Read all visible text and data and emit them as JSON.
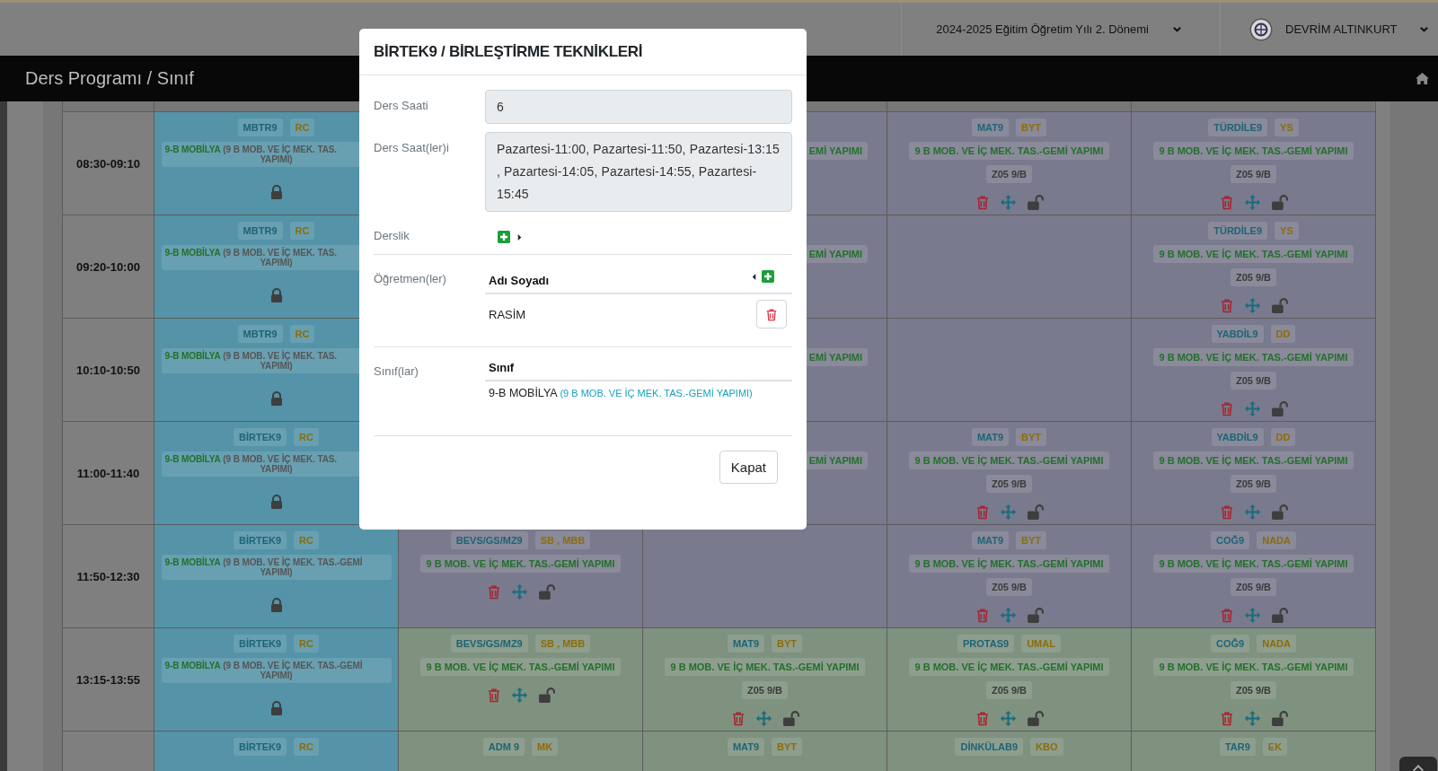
{
  "top_bar": {
    "semester": "2024-2025 Eğitim Öğretim Yılı 2. Dönemi",
    "user": "DEVRİM ALTINKURT"
  },
  "page_title": "Ders Programı / Sınıf",
  "timetable": {
    "rows": [
      {
        "time": "08:30-09:10",
        "cells": [
          {
            "kind": "locked",
            "color": "#5493a8",
            "course": "MBTR9",
            "teacher": "RC",
            "class": "9-B MOBİLYA",
            "detail": [
              "(9 B MOB. VE İÇ MEK. TAS.",
              "YAPIMI)"
            ]
          },
          {
            "kind": "empty"
          },
          {
            "kind": "partial",
            "color": "#7a7a8e",
            "text": "EMİ YAPIMI"
          },
          {
            "kind": "lesson",
            "color": "#7a7a8e",
            "course": "MAT9",
            "teacher": "BYT",
            "group": "9 B MOB. VE İÇ MEK. TAS.-GEMİ YAPIMI",
            "room": "Z05 9/B"
          },
          {
            "kind": "lesson",
            "color": "#7a7a8e",
            "course": "TÜRDİLE9",
            "teacher": "YS",
            "group": "9 B MOB. VE İÇ MEK. TAS.-GEMİ YAPIMI",
            "room": "Z05 9/B"
          }
        ]
      },
      {
        "time": "09:20-10:00",
        "cells": [
          {
            "kind": "locked",
            "color": "#5493a8",
            "course": "MBTR9",
            "teacher": "RC",
            "class": "9-B MOBİLYA",
            "detail": [
              "(9 B MOB. VE İÇ MEK. TAS.",
              "YAPIMI)"
            ]
          },
          {
            "kind": "empty"
          },
          {
            "kind": "partial",
            "color": "#7a7a8e",
            "text": "EMİ YAPIMI"
          },
          {
            "kind": "empty",
            "color": "#7a7a8e"
          },
          {
            "kind": "lesson",
            "color": "#7a7a8e",
            "course": "TÜRDİLE9",
            "teacher": "YS",
            "group": "9 B MOB. VE İÇ MEK. TAS.-GEMİ YAPIMI",
            "room": "Z05 9/B"
          }
        ]
      },
      {
        "time": "10:10-10:50",
        "cells": [
          {
            "kind": "locked",
            "color": "#5493a8",
            "course": "MBTR9",
            "teacher": "RC",
            "class": "9-B MOBİLYA",
            "detail": [
              "(9 B MOB. VE İÇ MEK. TAS.",
              "YAPIMI)"
            ]
          },
          {
            "kind": "empty"
          },
          {
            "kind": "partial",
            "color": "#7a7a8e",
            "text": "EMİ YAPIMI"
          },
          {
            "kind": "empty",
            "color": "#7a7a8e"
          },
          {
            "kind": "lesson",
            "color": "#7a7a8e",
            "course": "YABDİL9",
            "teacher": "DD",
            "group": "9 B MOB. VE İÇ MEK. TAS.-GEMİ YAPIMI",
            "room": "Z05 9/B"
          }
        ]
      },
      {
        "time": "11:00-11:40",
        "cells": [
          {
            "kind": "locked",
            "color": "#5493a8",
            "course": "BİRTEK9",
            "teacher": "RC",
            "class": "9-B MOBİLYA",
            "detail": [
              "(9 B MOB. VE İÇ MEK. TAS.",
              "YAPIMI)"
            ]
          },
          {
            "kind": "empty"
          },
          {
            "kind": "partial",
            "color": "#7a7a8e",
            "text": "EMİ YAPIMI"
          },
          {
            "kind": "lesson",
            "color": "#7a7a8e",
            "course": "MAT9",
            "teacher": "BYT",
            "group": "9 B MOB. VE İÇ MEK. TAS.-GEMİ YAPIMI",
            "room": "Z05 9/B"
          },
          {
            "kind": "lesson",
            "color": "#7a7a8e",
            "course": "YABDİL9",
            "teacher": "DD",
            "group": "9 B MOB. VE İÇ MEK. TAS.-GEMİ YAPIMI",
            "room": "Z05 9/B"
          }
        ]
      },
      {
        "time": "11:50-12:30",
        "cells": [
          {
            "kind": "locked",
            "color": "#5493a8",
            "course": "BİRTEK9",
            "teacher": "RC",
            "class": "9-B MOBİLYA",
            "detail": [
              "(9 B MOB. VE İÇ MEK. TAS.-GEMİ",
              "YAPIMI)"
            ]
          },
          {
            "kind": "lesson",
            "color": "#7a7a8e",
            "course": "BEVS/GS/MZ9",
            "teacher": "SB , MBB",
            "group": "9 B MOB. VE İÇ MEK. TAS.-GEMİ YAPIMI"
          },
          {
            "kind": "empty",
            "color": "#7a7a8e"
          },
          {
            "kind": "lesson",
            "color": "#7a7a8e",
            "course": "MAT9",
            "teacher": "BYT",
            "group": "9 B MOB. VE İÇ MEK. TAS.-GEMİ YAPIMI",
            "room": "Z05 9/B"
          },
          {
            "kind": "lesson",
            "color": "#7a7a8e",
            "course": "COĞ9",
            "teacher": "NADA",
            "group": "9 B MOB. VE İÇ MEK. TAS.-GEMİ YAPIMI",
            "room": "Z05 9/B"
          }
        ]
      },
      {
        "time": "13:15-13:55",
        "cells": [
          {
            "kind": "locked",
            "color": "#5493a8",
            "course": "BİRTEK9",
            "teacher": "RC",
            "class": "9-B MOBİLYA",
            "detail": [
              "(9 B MOB. VE İÇ MEK. TAS.-GEMİ",
              "YAPIMI)"
            ]
          },
          {
            "kind": "lesson",
            "color": "#7f917f",
            "course": "BEVS/GS/MZ9",
            "teacher": "SB , MBB",
            "group": "9 B MOB. VE İÇ MEK. TAS.-GEMİ YAPIMI"
          },
          {
            "kind": "lesson",
            "color": "#7f917f",
            "course": "MAT9",
            "teacher": "BYT",
            "group": "9 B MOB. VE İÇ MEK. TAS.-GEMİ YAPIMI",
            "room": "Z05 9/B"
          },
          {
            "kind": "lesson",
            "color": "#7f917f",
            "course": "PROTAS9",
            "teacher": "UMAL",
            "group": "9 B MOB. VE İÇ MEK. TAS.-GEMİ YAPIMI",
            "room": "Z05 9/B"
          },
          {
            "kind": "lesson",
            "color": "#7f917f",
            "course": "COĞ9",
            "teacher": "NADA",
            "group": "9 B MOB. VE İÇ MEK. TAS.-GEMİ YAPIMI",
            "room": "Z05 9/B"
          }
        ]
      },
      {
        "cells": [
          {
            "kind": "lesson",
            "color": "#5493a8",
            "course": "BİRTEK9",
            "teacher": "RC"
          },
          {
            "kind": "lesson",
            "color": "#7f917f",
            "course": "ADM 9",
            "teacher": "MK"
          },
          {
            "kind": "lesson",
            "color": "#7f917f",
            "course": "MAT9",
            "teacher": "BYT"
          },
          {
            "kind": "lesson",
            "color": "#7f917f",
            "course": "DİNKÜLAB9",
            "teacher": "KBO"
          },
          {
            "kind": "lesson",
            "color": "#7f917f",
            "course": "TAR9",
            "teacher": "EK"
          }
        ]
      }
    ]
  },
  "modal": {
    "title": "BİRTEK9 / BİRLEŞTİRME TEKNİKLERİ",
    "fields": [
      {
        "kind": "readonly",
        "label": "Ders Saati",
        "value": "6"
      },
      {
        "kind": "textarea",
        "label": "Ders Saat(ler)i",
        "value": "Pazartesi-11:00, Pazartesi-11:50, Pazartesi-13:15 , Pazartesi-14:05, Pazartesi-14:55, Pazartesi-15:45"
      },
      {
        "kind": "add",
        "label": "Derslik"
      },
      {
        "kind": "teachers",
        "label": "Öğretmen(ler)",
        "column": "Adı Soyadı",
        "rows": [
          "RASİM"
        ]
      },
      {
        "kind": "classes",
        "label": "Sınıf(lar)",
        "column": "Sınıf",
        "rows": [
          {
            "name": "9-B MOBİLYA",
            "detail": "(9 B MOB. VE İÇ MEK. TAS.-GEMİ YAPIMI)"
          }
        ]
      }
    ],
    "close": "Kapat"
  }
}
